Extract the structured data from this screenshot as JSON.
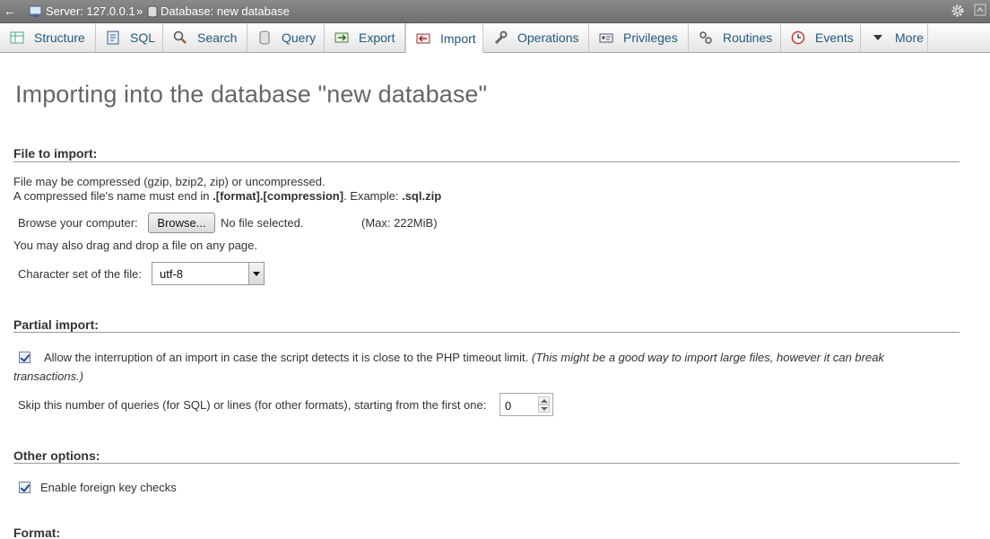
{
  "breadcrumb": {
    "server": "Server: 127.0.0.1",
    "separator": "»",
    "database": "Database: new database"
  },
  "tabs": [
    {
      "label": "Structure",
      "icon": "structure-icon"
    },
    {
      "label": "SQL",
      "icon": "sql-icon"
    },
    {
      "label": "Search",
      "icon": "search-icon"
    },
    {
      "label": "Query",
      "icon": "query-icon"
    },
    {
      "label": "Export",
      "icon": "export-icon"
    },
    {
      "label": "Import",
      "icon": "import-icon",
      "active": true
    },
    {
      "label": "Operations",
      "icon": "wrench-icon"
    },
    {
      "label": "Privileges",
      "icon": "privileges-icon"
    },
    {
      "label": "Routines",
      "icon": "routines-icon"
    },
    {
      "label": "Events",
      "icon": "clock-icon"
    },
    {
      "label": "More",
      "icon": "chevron-down-icon"
    }
  ],
  "page_title": "Importing into the database \"new database\"",
  "file_section": {
    "legend": "File to import:",
    "note1": "File may be compressed (gzip, bzip2, zip) or uncompressed.",
    "note2_prefix": "A compressed file's name must end in ",
    "note2_bold": ".[format].[compression]",
    "note2_mid": ". Example: ",
    "note2_example": ".sql.zip",
    "browse_label": "Browse your computer:",
    "browse_button": "Browse...",
    "file_status": "No file selected.",
    "max_size": "(Max: 222MiB)",
    "drag_note": "You may also drag and drop a file on any page.",
    "charset_label": "Character set of the file:",
    "charset_value": "utf-8"
  },
  "partial_section": {
    "legend": "Partial import:",
    "allow_interrupt_label": "Allow the interruption of an import in case the script detects it is close to the PHP timeout limit.",
    "allow_interrupt_note_1": "(This might be a good way to import large files, however it can break",
    "allow_interrupt_note_2": "transactions.)",
    "allow_interrupt_checked": true,
    "skip_label": "Skip this number of queries (for SQL) or lines (for other formats), starting from the first one:",
    "skip_value": "0"
  },
  "other_section": {
    "legend": "Other options:",
    "fk_label": "Enable foreign key checks",
    "fk_checked": true
  },
  "format_section": {
    "legend": "Format:"
  },
  "colors": {
    "tab_text": "#235a81",
    "topbar": "#7c7c7c",
    "title": "#666666"
  }
}
